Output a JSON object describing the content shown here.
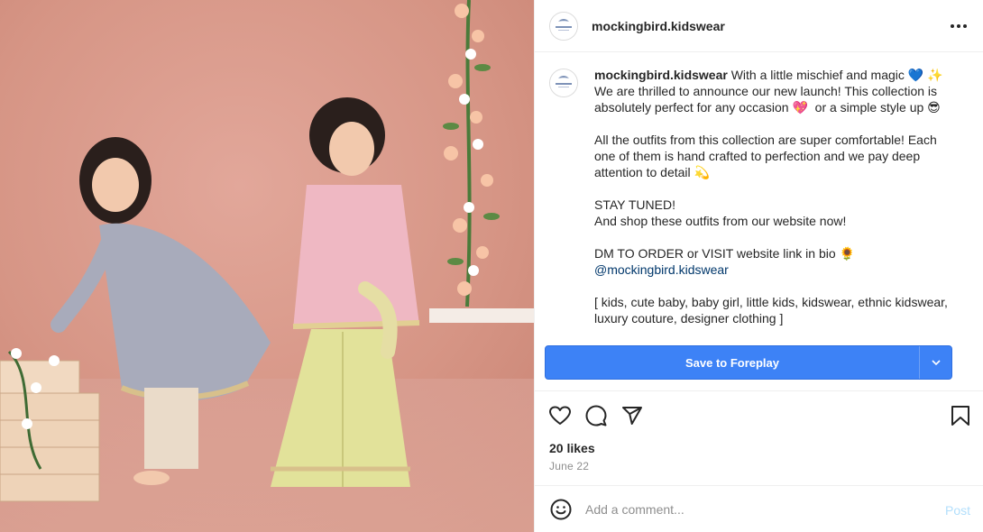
{
  "photo": {
    "alt_icon": "kids-fashion-photo"
  },
  "header": {
    "username": "mockingbird.kidswear",
    "avatar_icon": "mockingbird-logo-icon",
    "more_icon": "more-options-icon"
  },
  "caption": {
    "username": "mockingbird.kidswear",
    "line1": " With a little mischief and magic 💙 ✨",
    "line2": "We are thrilled to announce our new launch! This collection is absolutely perfect for any occasion 💖  or a simple style up 😎",
    "line3": "All the outfits from this collection are super comfortable! Each one of them is hand crafted to perfection and we pay deep attention to detail 💫",
    "line4": "STAY TUNED!",
    "line5": "And shop these outfits from our website now!",
    "line6": "DM TO ORDER or VISIT website link in bio 🌻",
    "mention": "@mockingbird.kidswear",
    "line7": "[ kids, cute baby, baby girl, little kids, kidswear, ethnic kidswear, luxury couture, designer clothing ]"
  },
  "save_bar": {
    "label": "Save to Foreplay",
    "color": "#3d82f6"
  },
  "actions": {
    "like_icon": "heart-icon",
    "comment_icon": "comment-icon",
    "share_icon": "share-icon",
    "save_icon": "bookmark-icon"
  },
  "likes": "20 likes",
  "date": "June 22",
  "comment": {
    "placeholder": "Add a comment...",
    "post_label": "Post",
    "emoji_icon": "emoji-icon"
  }
}
